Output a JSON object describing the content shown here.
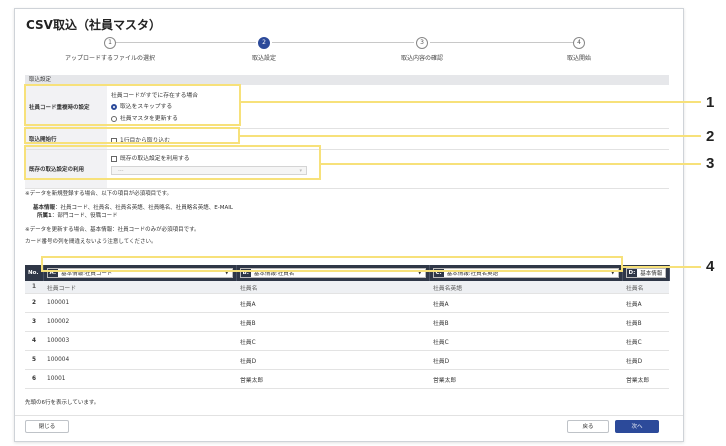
{
  "dialog": {
    "title": "CSV取込（社員マスタ）"
  },
  "stepper": {
    "steps": [
      {
        "num": "1",
        "label": "アップロードするファイルの選択"
      },
      {
        "num": "2",
        "label": "取込設定"
      },
      {
        "num": "3",
        "label": "取込内容の確認"
      },
      {
        "num": "4",
        "label": "取込開始"
      }
    ],
    "active_index": 1
  },
  "settings": {
    "header": "取込設定",
    "dup": {
      "label": "社員コード重複時の設定",
      "question": "社員コードがすでに存在する場合",
      "option_skip": "取込をスキップする",
      "option_update": "社員マスタを更新する",
      "selected": "skip"
    },
    "start_row": {
      "label": "取込開始行",
      "option": "1行目から取り込む"
    },
    "existing": {
      "label": "既存の取込設定の利用",
      "option": "既存の取込設定を利用する",
      "placeholder": "---"
    }
  },
  "notes": {
    "line1": "※データを新規登録する場合、以下の項目が必須項目です。",
    "basic_label": "基本情報",
    "basic_text": "：社員コード、社員名、社員名英語、社員略名、社員略名英語、E-MAIL",
    "aff_label": "所属1",
    "aff_text": "：部門コード、役職コード",
    "line4": "※データを更新する場合、基本情報：社員コードのみが必須項目です。",
    "line5": "カード番号の列を間違えないよう注意してください。"
  },
  "table": {
    "no_header": "No.",
    "columns": [
      {
        "key": "A:",
        "value": "基本情報:社員コード"
      },
      {
        "key": "B:",
        "value": "基本情報:社員名"
      },
      {
        "key": "C:",
        "value": "基本情報:社員名英語"
      },
      {
        "key": "D:",
        "value": "基本情報:社員"
      }
    ],
    "rows": [
      {
        "no": "1",
        "cells": [
          "社員コード",
          "社員名",
          "社員名英語",
          "社員名"
        ]
      },
      {
        "no": "2",
        "cells": [
          "100001",
          "社員A",
          "社員A",
          "社員A"
        ]
      },
      {
        "no": "3",
        "cells": [
          "100002",
          "社員B",
          "社員B",
          "社員B"
        ]
      },
      {
        "no": "4",
        "cells": [
          "100003",
          "社員C",
          "社員C",
          "社員C"
        ]
      },
      {
        "no": "5",
        "cells": [
          "100004",
          "社員D",
          "社員D",
          "社員D"
        ]
      },
      {
        "no": "6",
        "cells": [
          "10001",
          "営業太郎",
          "営業太郎",
          "営業太郎"
        ]
      }
    ],
    "footer": "先頭の6行を表示しています。"
  },
  "buttons": {
    "close": "閉じる",
    "back": "戻る",
    "next": "次へ"
  },
  "callouts": [
    "1",
    "2",
    "3",
    "4"
  ],
  "colors": {
    "primary": "#2c4a9a",
    "table_header": "#2f3747",
    "highlight": "#f7e17a"
  }
}
